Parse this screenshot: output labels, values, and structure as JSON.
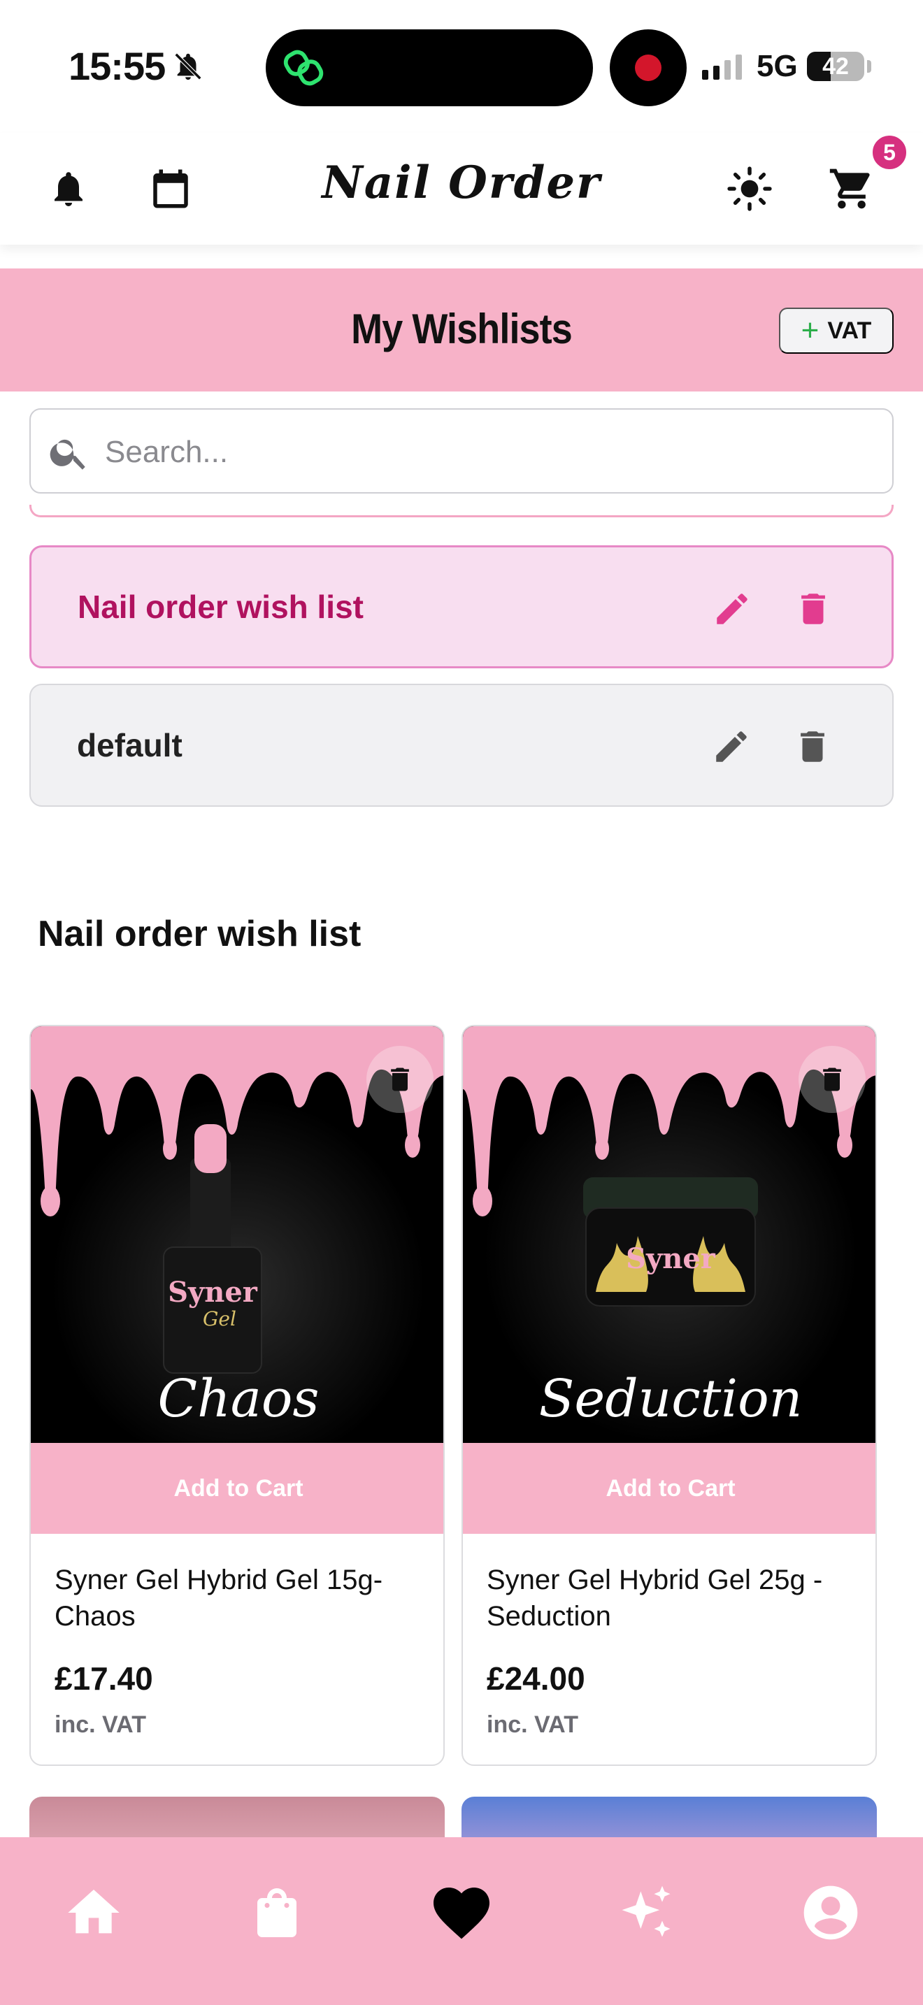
{
  "status_bar": {
    "time": "15:55",
    "network": "5G",
    "battery_level": "42",
    "battery_fraction": 0.42,
    "recording_color": "#d3162b"
  },
  "header": {
    "logo": "Nail Order",
    "cart_count": "5",
    "icons": [
      "bell-icon",
      "calendar-icon",
      "sun-icon",
      "cart-icon"
    ],
    "badge_color": "#d6307f"
  },
  "title_bar": {
    "title": "My Wishlists",
    "vat_toggle_plus": "+",
    "vat_toggle_label": "VAT",
    "background_color": "#f7b2c8"
  },
  "search": {
    "placeholder": "Search...",
    "value": ""
  },
  "wishlists": [
    {
      "name": "Nail order wish list",
      "active": true
    },
    {
      "name": "default",
      "active": false
    }
  ],
  "section": {
    "title": "Nail order wish list"
  },
  "products": [
    {
      "name": "Syner Gel Hybrid Gel 15g- Chaos",
      "price": "£17.40",
      "vat_note": "inc. VAT",
      "add_to_cart": "Add to Cart",
      "image_caption": "Chaos"
    },
    {
      "name": "Syner Gel Hybrid Gel 25g - Seduction",
      "price": "£24.00",
      "vat_note": "inc. VAT",
      "add_to_cart": "Add to Cart",
      "image_caption": "Seduction"
    }
  ],
  "bottom_nav": {
    "items": [
      "home-icon",
      "shopping-bag-icon",
      "heart-icon",
      "sparkles-icon",
      "account-icon"
    ],
    "active": "heart-icon"
  }
}
